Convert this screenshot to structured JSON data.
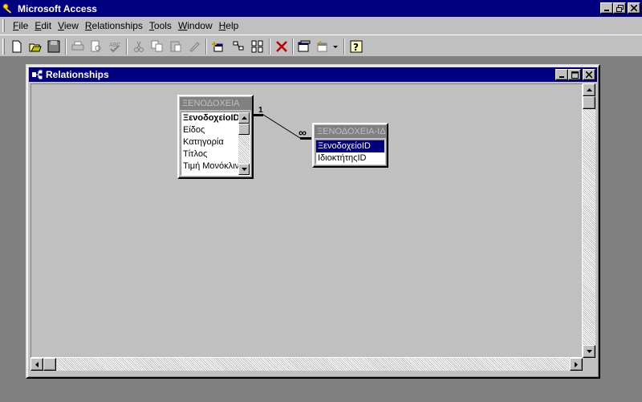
{
  "app": {
    "title": "Microsoft Access"
  },
  "menu": [
    {
      "label": "File",
      "key": "F",
      "rest": "ile"
    },
    {
      "label": "Edit",
      "key": "E",
      "rest": "dit"
    },
    {
      "label": "View",
      "key": "V",
      "rest": "iew"
    },
    {
      "label": "Relationships",
      "key": "R",
      "rest": "elationships"
    },
    {
      "label": "Tools",
      "key": "T",
      "rest": "ools"
    },
    {
      "label": "Window",
      "key": "W",
      "rest": "indow"
    },
    {
      "label": "Help",
      "key": "H",
      "rest": "elp"
    }
  ],
  "toolbar": {
    "icons": [
      "new-icon",
      "open-icon",
      "save-icon",
      "print-icon",
      "print-preview-icon",
      "spelling-icon",
      "cut-icon",
      "copy-icon",
      "paste-icon",
      "format-painter-icon",
      "show-table-icon",
      "show-direct-icon",
      "show-all-icon",
      "delete-icon",
      "new-object-icon",
      "office-links-icon",
      "help-icon"
    ]
  },
  "child": {
    "title": "Relationships"
  },
  "tables": {
    "hotels": {
      "title": "ΞΕΝΟΔΟΧΕΙΑ",
      "fields": [
        "ΞενοδοχείοID",
        "Είδος",
        "Κατηγορία",
        "Τίτλος",
        "Τιμή Μονόκλιν"
      ]
    },
    "owners": {
      "title": "ΞΕΝΟΔΟΧΕΙΑ-ΙΔΙ",
      "fields": [
        "ΞενοδοχείοID",
        "ΙδιοκτήτηςID"
      ]
    }
  },
  "relationship": {
    "one_label": "1",
    "many_label": "∞"
  },
  "colors": {
    "titlebar": "#000080",
    "face": "#c0c0c0",
    "desktop": "#808080"
  }
}
